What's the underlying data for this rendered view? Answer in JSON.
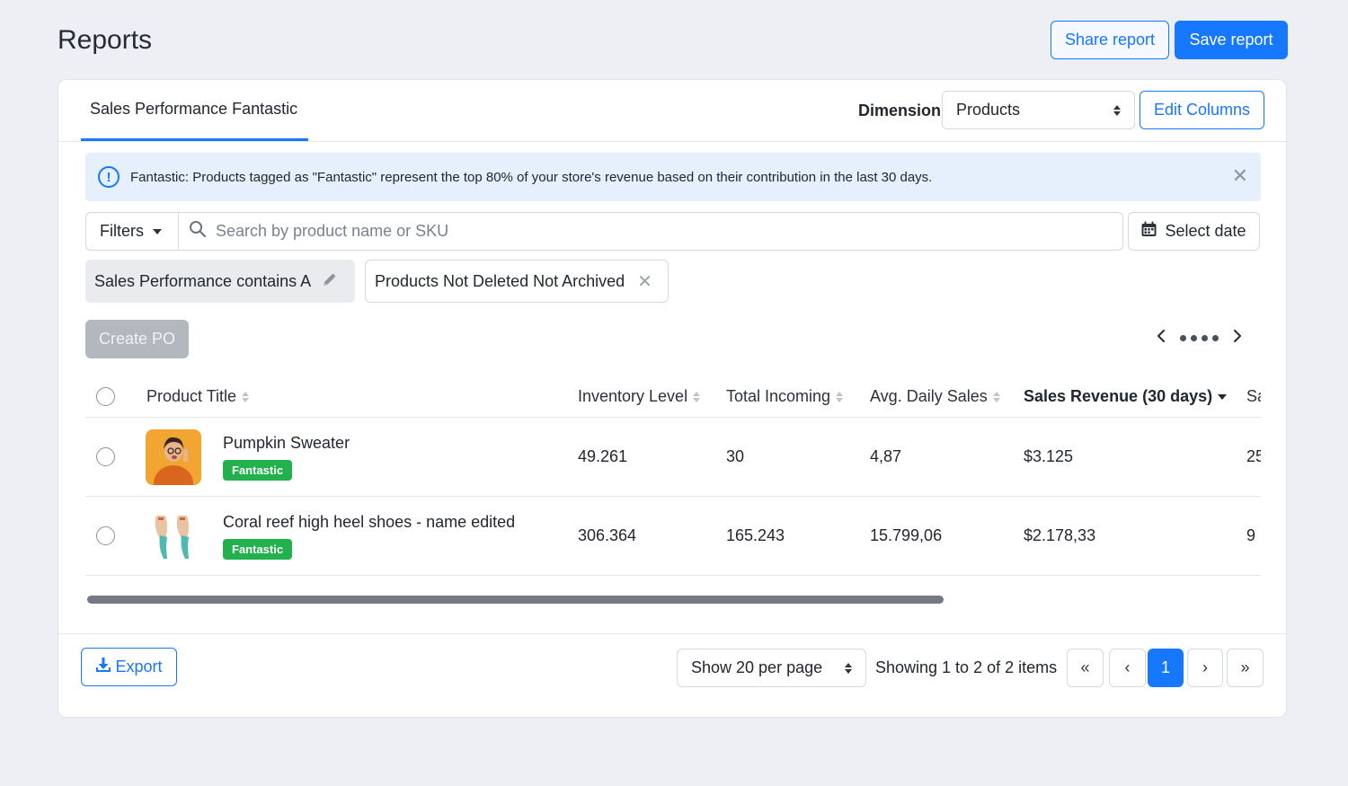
{
  "page": {
    "title": "Reports"
  },
  "header": {
    "share_label": "Share report",
    "save_label": "Save report"
  },
  "tab": {
    "label": "Sales Performance Fantastic"
  },
  "dimension": {
    "label": "Dimension",
    "value": "Products",
    "edit_columns_label": "Edit Columns"
  },
  "info_banner": {
    "text": "Fantastic: Products tagged as \"Fantastic\" represent the top 80% of your store's revenue based on their contribution in the last 30 days.",
    "icon": "info-circle-icon"
  },
  "filters": {
    "label": "Filters",
    "search_placeholder": "Search by product name or SKU",
    "date_label": "Select date"
  },
  "chips": [
    {
      "label": "Sales Performance contains A",
      "icon": "pencil-icon"
    },
    {
      "label": "Products Not Deleted Not Archived",
      "icon": "close-icon"
    }
  ],
  "actions": {
    "create_po_label": "Create PO"
  },
  "table": {
    "columns": [
      "Product Title",
      "Inventory Level",
      "Total Incoming",
      "Avg. Daily Sales",
      "Sales Revenue (30 days)",
      "Sa"
    ],
    "rows": [
      {
        "name": "Pumpkin Sweater",
        "badge": "Fantastic",
        "inventory": "49.261",
        "incoming": "30",
        "avg_daily": "4,87",
        "revenue": "$3.125",
        "extra": "25"
      },
      {
        "name": "Coral reef high heel shoes - name edited",
        "badge": "Fantastic",
        "inventory": "306.364",
        "incoming": "165.243",
        "avg_daily": "15.799,06",
        "revenue": "$2.178,33",
        "extra": "9"
      }
    ]
  },
  "footer": {
    "export_label": "Export",
    "per_page_label": "Show 20 per page",
    "showing_text": "Showing 1 to 2 of 2 items",
    "pages": {
      "first": "«",
      "prev": "‹",
      "current": "1",
      "next": "›",
      "last": "»"
    }
  },
  "colors": {
    "accent": "#1677ff",
    "badge": "#22b14c",
    "info_bg": "#e6effc",
    "page_bg": "#edeff5"
  }
}
